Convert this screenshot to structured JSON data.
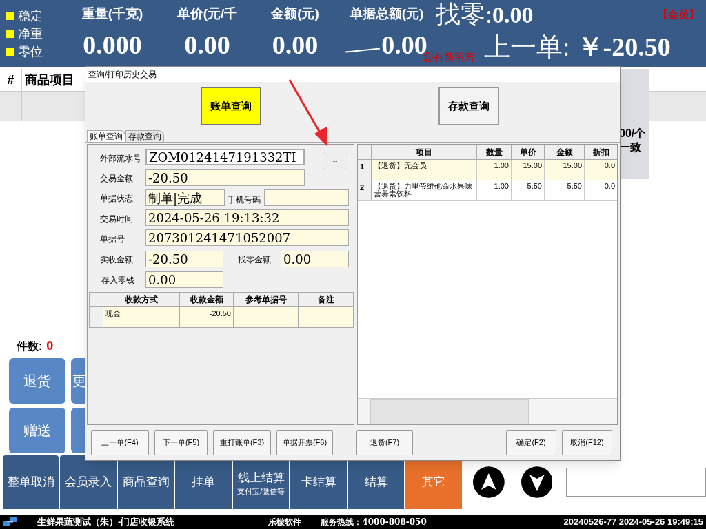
{
  "header": {
    "indicators": [
      {
        "label": "稳定"
      },
      {
        "label": "净重"
      },
      {
        "label": "零位"
      }
    ],
    "readouts": [
      {
        "label": "重量(千克)",
        "value": "0.000"
      },
      {
        "label": "单价(元/千",
        "value": "0.00"
      },
      {
        "label": "金额(元)",
        "value": "0.00"
      },
      {
        "label": "单据总额(元)",
        "value": "0.00",
        "struck": true
      }
    ],
    "change": {
      "label": "找零:",
      "value": "0.00"
    },
    "member_tag": "【会员】",
    "message": "您有新留言",
    "last_order": {
      "label": "上一单:",
      "value": "￥-20.50"
    }
  },
  "cart": {
    "columns": [
      "#",
      "商品项目"
    ]
  },
  "side_panel": {
    "lines": [
      "00/个",
      "一致"
    ]
  },
  "item_count": {
    "label": "件数:",
    "value": "0"
  },
  "quick_buttons": [
    {
      "kind": "text",
      "label": "退货"
    },
    {
      "kind": "text",
      "label": "更"
    },
    {
      "kind": "text",
      "label": "赠送"
    },
    {
      "kind": "blank"
    }
  ],
  "bottom_buttons": [
    {
      "label": "整单取消",
      "kind": "plain"
    },
    {
      "label": "会员录入",
      "kind": "plain"
    },
    {
      "label": "商品查询",
      "kind": "plain"
    },
    {
      "label": "挂单",
      "kind": "plain"
    },
    {
      "label": "线上结算",
      "sub": "支付宝/微信等",
      "kind": "plain"
    },
    {
      "label": "卡结算",
      "kind": "plain"
    },
    {
      "label": "结算",
      "kind": "plain"
    },
    {
      "label": "其它",
      "kind": "accent"
    }
  ],
  "status_bar": {
    "store": "生鲜果蔬测试（朱）-门店收银系统",
    "vendor": "乐檬软件",
    "hotline": "服务热线：4000-808-050",
    "session": "20240526-77 2024-05-26 19:49:15"
  },
  "dialog": {
    "title": "查询/打印历史交易",
    "mode_buttons": [
      {
        "label": "账单查询",
        "selected": true
      },
      {
        "label": "存款查询",
        "selected": false
      }
    ],
    "tabs": [
      {
        "label": "账单查询",
        "selected": true
      },
      {
        "label": "存款查询",
        "selected": false
      }
    ],
    "fields": {
      "external_serial": {
        "label": "外部流水号",
        "value": "ZOM0124147191332TI"
      },
      "amount": {
        "label": "交易金额",
        "value": "-20.50"
      },
      "status": {
        "label": "单据状态",
        "value": "制单|完成"
      },
      "phone": {
        "label": "手机号码"
      },
      "time": {
        "label": "交易时间",
        "value": "2024-05-26 19:13:32"
      },
      "bill_no": {
        "label": "单据号",
        "value": "207301241471052007"
      },
      "received": {
        "label": "实收金额",
        "value": "-20.50"
      },
      "change": {
        "label": "找零金额",
        "value": "0.00"
      },
      "deposit": {
        "label": "存入零钱",
        "value": "0.00"
      }
    },
    "browse_button": "...",
    "payments": {
      "columns": [
        "收款方式",
        "收款金额",
        "参考单据号",
        "备注"
      ],
      "rows": [
        [
          "现金",
          "-20.50",
          "",
          ""
        ]
      ]
    },
    "items": {
      "columns": [
        "项目",
        "数量",
        "单价",
        "金额",
        "折扣"
      ],
      "rows": [
        {
          "no": "1",
          "cells": [
            "【退货】无会员",
            "1.00",
            "15.00",
            "15.00",
            "0.0"
          ],
          "selected": true
        },
        {
          "no": "2",
          "cells": [
            "【退货】力里帝维他命水果味营养素饮料",
            "1.00",
            "5.50",
            "5.50",
            "0.0"
          ],
          "selected": false
        }
      ]
    },
    "buttons": [
      "上一单(F4)",
      "下一单(F5)",
      "重打账单(F3)",
      "单据开票(F6)",
      "退货(F7)",
      "确定(F2)",
      "取消(F12)"
    ]
  }
}
